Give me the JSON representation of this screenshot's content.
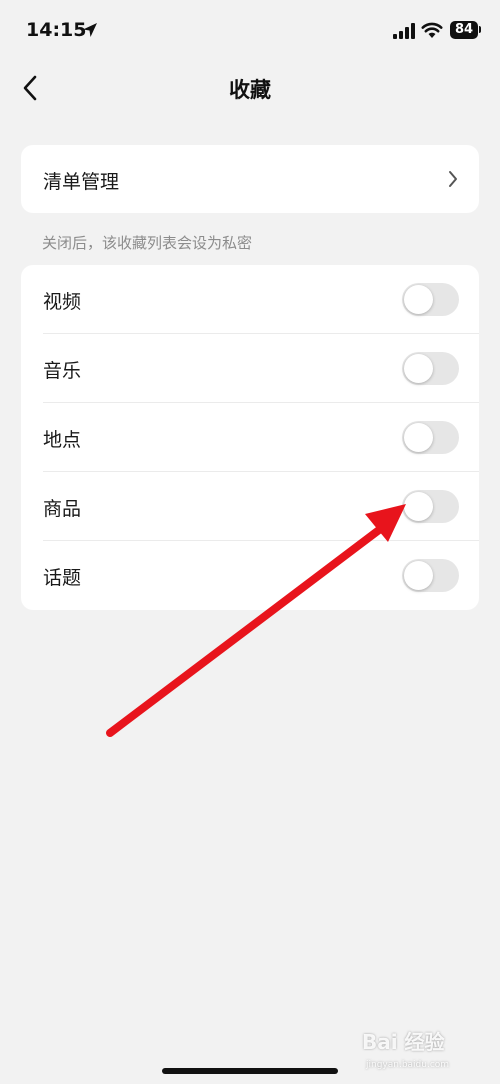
{
  "status_bar": {
    "time": "14:15",
    "battery": "84",
    "icons": [
      "location-arrow-icon",
      "cellular-signal-icon",
      "wifi-icon",
      "battery-icon"
    ]
  },
  "nav": {
    "title": "收藏",
    "back_icon": "chevron-left-icon"
  },
  "list_management": {
    "label": "清单管理",
    "icon": "chevron-right-icon"
  },
  "privacy_note": "关闭后，该收藏列表会设为私密",
  "toggles": [
    {
      "label": "视频",
      "on": false
    },
    {
      "label": "音乐",
      "on": false
    },
    {
      "label": "地点",
      "on": false
    },
    {
      "label": "商品",
      "on": false
    },
    {
      "label": "话题",
      "on": false
    }
  ],
  "annotation": {
    "color": "#e8141c"
  },
  "watermark": {
    "text": "Bai 经验",
    "url": "jingyan.baidu.com"
  },
  "colors": {
    "background": "#f2f2f2",
    "card": "#ffffff",
    "switch_off": "#e6e6e6",
    "note_text": "#8c8c8c"
  }
}
